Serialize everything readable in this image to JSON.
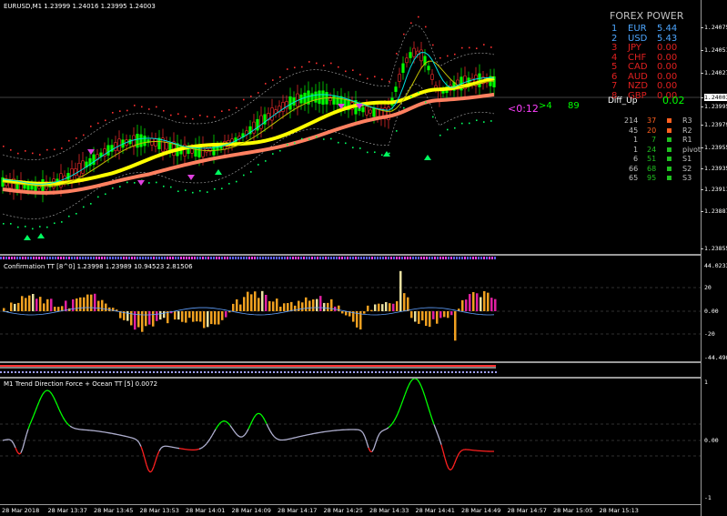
{
  "chart_header": {
    "symbol_line": "EURUSD,M1  1.23999 1.24016 1.23995 1.24003"
  },
  "forex_power": {
    "title": "FOREX POWER",
    "rows": [
      {
        "rank": "1",
        "ccy": "EUR",
        "val": "5.44",
        "color": "#4da6ff"
      },
      {
        "rank": "2",
        "ccy": "USD",
        "val": "5.43",
        "color": "#4da6ff"
      },
      {
        "rank": "3",
        "ccy": "JPY",
        "val": "0.00",
        "color": "#e02020"
      },
      {
        "rank": "4",
        "ccy": "CHF",
        "val": "0.00",
        "color": "#e02020"
      },
      {
        "rank": "5",
        "ccy": "CAD",
        "val": "0.00",
        "color": "#e02020"
      },
      {
        "rank": "6",
        "ccy": "AUD",
        "val": "0.00",
        "color": "#e02020"
      },
      {
        "rank": "7",
        "ccy": "NZD",
        "val": "0.00",
        "color": "#e02020"
      },
      {
        "rank": "8",
        "ccy": "GBP",
        "val": "0.00",
        "color": "#e02020"
      }
    ],
    "diff_label": "Diff_Up",
    "diff_value": "0.02"
  },
  "countdown": {
    "timer": "<0:12",
    "spread": ">4",
    "value": "89"
  },
  "pivots": [
    {
      "a": "214",
      "b": "37",
      "color": "#ff6020",
      "label": "R3"
    },
    {
      "a": "45",
      "b": "20",
      "color": "#ff6020",
      "label": "R2"
    },
    {
      "a": "1",
      "b": "7",
      "color": "#20c020",
      "label": "R1"
    },
    {
      "a": "1",
      "b": "24",
      "color": "#20c020",
      "label": "pivot"
    },
    {
      "a": "6",
      "b": "51",
      "color": "#20c020",
      "label": "S1"
    },
    {
      "a": "66",
      "b": "68",
      "color": "#20c020",
      "label": "S2"
    },
    {
      "a": "65",
      "b": "95",
      "color": "#20c020",
      "label": "S3"
    }
  ],
  "price_axis": [
    "1.24075",
    "1.24051",
    "1.24027",
    "1.24003",
    "1.23995",
    "1.23979",
    "1.23955",
    "1.23935",
    "1.23911",
    "1.23887",
    "1.23855"
  ],
  "indicator1": {
    "title": "Confirmation TT [8^0] 1.23998 1.23989 10.94523 2.81506",
    "axis": [
      "44.02334",
      "20",
      "0.00",
      "-20",
      "-44.49004"
    ]
  },
  "indicator2": {
    "title": "M1 Trend Direction Force + Ocean TT [5] 0.0072",
    "axis": [
      "1",
      "0.00",
      "-1"
    ]
  },
  "time_axis": [
    "28 Mar 2018",
    "28 Mar 13:37",
    "28 Mar 13:45",
    "28 Mar 13:53",
    "28 Mar 14:01",
    "28 Mar 14:09",
    "28 Mar 14:17",
    "28 Mar 14:25",
    "28 Mar 14:33",
    "28 Mar 14:41",
    "28 Mar 14:49",
    "28 Mar 14:57",
    "28 Mar 15:05",
    "28 Mar 15:13"
  ],
  "colors": {
    "bull": "#00ff00",
    "bear": "#ff3030",
    "ma_yellow": "#ffff00",
    "ma_salmon": "#ff8060",
    "hist_orange": "#f0a020",
    "hist_magenta": "#e020a0",
    "tdf_green": "#00ff00",
    "tdf_red": "#ff2020",
    "tdf_gray": "#b0b0d0"
  }
}
